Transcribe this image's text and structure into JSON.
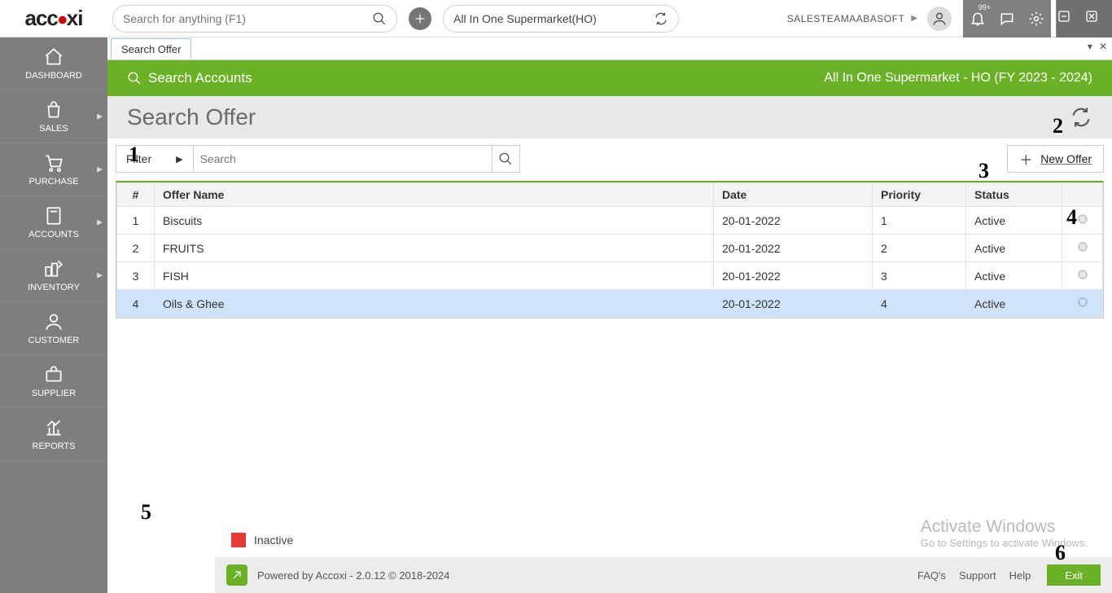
{
  "top": {
    "logo_a": "acc",
    "logo_b": "xi",
    "search_placeholder": "Search for anything (F1)",
    "company": "All In One Supermarket(HO)",
    "username": "SALESTEAMAABASOFT",
    "badge": "99+"
  },
  "sidebar": {
    "items": [
      {
        "label": "DASHBOARD",
        "icon": "home",
        "sub": false
      },
      {
        "label": "SALES",
        "icon": "bag",
        "sub": true
      },
      {
        "label": "PURCHASE",
        "icon": "cart",
        "sub": true
      },
      {
        "label": "ACCOUNTS",
        "icon": "calc",
        "sub": true
      },
      {
        "label": "INVENTORY",
        "icon": "inv",
        "sub": true
      },
      {
        "label": "CUSTOMER",
        "icon": "user",
        "sub": false
      },
      {
        "label": "SUPPLIER",
        "icon": "case",
        "sub": false
      },
      {
        "label": "REPORTS",
        "icon": "chart",
        "sub": false
      }
    ]
  },
  "tab": {
    "label": "Search Offer"
  },
  "greenbar": {
    "left": "Search Accounts",
    "right": "All In One Supermarket - HO (FY 2023 - 2024)"
  },
  "page": {
    "title": "Search Offer",
    "filter_label": "Filter",
    "search_placeholder": "Search",
    "new_offer_label": "New Offer"
  },
  "table": {
    "headers": {
      "idx": "#",
      "name": "Offer Name",
      "date": "Date",
      "priority": "Priority",
      "status": "Status"
    },
    "rows": [
      {
        "idx": "1",
        "name": "Biscuits",
        "date": "20-01-2022",
        "priority": "1",
        "status": "Active",
        "selected": false
      },
      {
        "idx": "2",
        "name": "FRUITS",
        "date": "20-01-2022",
        "priority": "2",
        "status": "Active",
        "selected": false
      },
      {
        "idx": "3",
        "name": "FISH",
        "date": "20-01-2022",
        "priority": "3",
        "status": "Active",
        "selected": false
      },
      {
        "idx": "4",
        "name": "Oils & Ghee",
        "date": "20-01-2022",
        "priority": "4",
        "status": "Active",
        "selected": true
      }
    ]
  },
  "legend": {
    "inactive": "Inactive"
  },
  "footer": {
    "powered": "Powered by Accoxi - 2.0.12 © 2018-2024",
    "links": [
      "FAQ's",
      "Support",
      "Help"
    ],
    "exit": "Exit"
  },
  "watermark": {
    "l1": "Activate Windows",
    "l2": "Go to Settings to activate Windows."
  },
  "annotations": {
    "a1": "1",
    "a2": "2",
    "a3": "3",
    "a4": "4",
    "a5": "5",
    "a6": "6"
  }
}
